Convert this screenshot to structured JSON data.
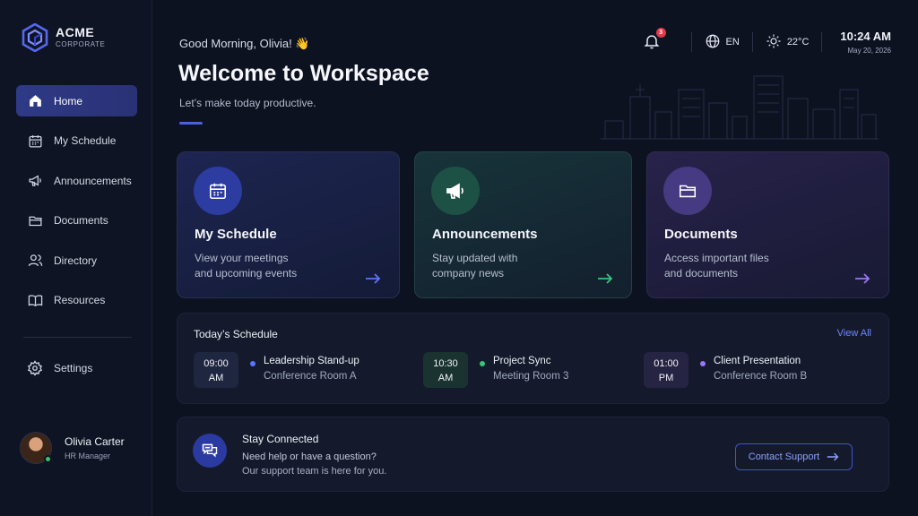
{
  "brand": {
    "name": "ACME",
    "subtitle": "CORPORATE"
  },
  "sidebar": {
    "items": [
      {
        "label": "Home",
        "icon": "home-icon",
        "active": true
      },
      {
        "label": "My Schedule",
        "icon": "calendar-icon"
      },
      {
        "label": "Announcements",
        "icon": "megaphone-icon"
      },
      {
        "label": "Documents",
        "icon": "folder-icon"
      },
      {
        "label": "Directory",
        "icon": "users-icon"
      },
      {
        "label": "Resources",
        "icon": "book-icon"
      }
    ],
    "settings_label": "Settings"
  },
  "profile": {
    "name": "Olivia Carter",
    "role": "HR Manager",
    "status_color": "#36c46b"
  },
  "header": {
    "greeting": "Good Morning, Olivia! 👋",
    "title": "Welcome to Workspace",
    "subtitle": "Let’s make today productive.",
    "notifications_count": "3",
    "language": "EN",
    "temperature": "22°C",
    "time": "10:24 AM",
    "date": "May 20, 2026"
  },
  "cards": [
    {
      "title": "My Schedule",
      "desc_line1": "View your meetings",
      "desc_line2": "and upcoming events",
      "icon": "calendar-icon",
      "accent": "#5b74ff"
    },
    {
      "title": "Announcements",
      "desc_line1": "Stay updated with",
      "desc_line2": "company news",
      "icon": "megaphone-icon",
      "accent": "#38c47a"
    },
    {
      "title": "Documents",
      "desc_line1": "Access important files",
      "desc_line2": "and documents",
      "icon": "folder-icon",
      "accent": "#9a76f2"
    }
  ],
  "schedule": {
    "title": "Today’s Schedule",
    "view_all": "View All",
    "events": [
      {
        "time": "09:00",
        "ampm": "AM",
        "name": "Leadership Stand-up",
        "room": "Conference Room A"
      },
      {
        "time": "10:30",
        "ampm": "AM",
        "name": "Project Sync",
        "room": "Meeting Room 3"
      },
      {
        "time": "01:00",
        "ampm": "PM",
        "name": "Client Presentation",
        "room": "Conference Room B"
      }
    ]
  },
  "support": {
    "title": "Stay Connected",
    "line1": "Need help or have a question?",
    "line2": "Our support team is here for you.",
    "button": "Contact Support"
  },
  "colors": {
    "accent": "#4b62e0",
    "link": "#6f86ff",
    "background": "#0d1220"
  }
}
